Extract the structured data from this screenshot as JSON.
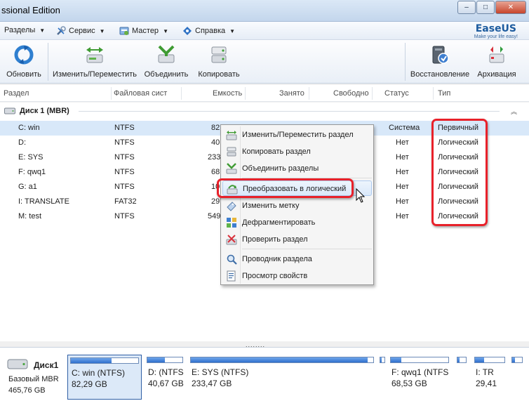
{
  "window": {
    "title": "ssional Edition",
    "buttons": {
      "minimize": "–",
      "maximize": "□",
      "close": "✕"
    }
  },
  "menubar": {
    "items": [
      {
        "label": "Разделы",
        "icon": "partitions-icon"
      },
      {
        "label": "Сервис",
        "icon": "tools-icon"
      },
      {
        "label": "Мастер",
        "icon": "wizard-icon"
      },
      {
        "label": "Справка",
        "icon": "help-icon"
      }
    ],
    "brand": {
      "name": "EaseUS",
      "tagline": "Make your life easy!"
    }
  },
  "toolbar": {
    "items": [
      {
        "label": "Обновить",
        "icon": "refresh-icon"
      },
      {
        "label": "Изменить/Переместить",
        "icon": "resize-move-icon"
      },
      {
        "label": "Объединить",
        "icon": "merge-icon"
      },
      {
        "label": "Копировать",
        "icon": "copy-disk-icon"
      },
      {
        "label": "Восстановление",
        "icon": "recovery-icon"
      },
      {
        "label": "Архивация",
        "icon": "backup-icon"
      }
    ]
  },
  "columns": [
    "Раздел",
    "Файловая сист",
    "Емкость",
    "Занято",
    "Свободно",
    "Статус",
    "Тип"
  ],
  "disk": {
    "header": "Диск 1 (MBR)",
    "partitions": [
      {
        "name": "C: win",
        "fs": "NTFS",
        "capacity": "82",
        "status": "Система",
        "type": "Первичный"
      },
      {
        "name": "D:",
        "fs": "NTFS",
        "capacity": "40",
        "status": "Нет",
        "type": "Логический"
      },
      {
        "name": "E: SYS",
        "fs": "NTFS",
        "capacity": "233",
        "status": "Нет",
        "type": "Логический"
      },
      {
        "name": "F: qwq1",
        "fs": "NTFS",
        "capacity": "68",
        "status": "Нет",
        "type": "Логический"
      },
      {
        "name": "G: a1",
        "fs": "NTFS",
        "capacity": "10",
        "status": "Нет",
        "type": "Логический"
      },
      {
        "name": "I: TRANSLATE",
        "fs": "FAT32",
        "capacity": "29",
        "status": "Нет",
        "type": "Логический"
      },
      {
        "name": "M: test",
        "fs": "NTFS",
        "capacity": "549",
        "status": "Нет",
        "type": "Логический"
      }
    ]
  },
  "context_menu": {
    "items": [
      {
        "label": "Изменить/Переместить раздел",
        "icon": "resize-move-icon"
      },
      {
        "label": "Копировать раздел",
        "icon": "copy-partition-icon"
      },
      {
        "label": "Объединить разделы",
        "icon": "merge-icon"
      },
      {
        "label": "Преобразовать в логический",
        "icon": "convert-logical-icon",
        "highlighted": true
      },
      {
        "label": "Изменить метку",
        "icon": "label-icon"
      },
      {
        "label": "Дефрагментировать",
        "icon": "defrag-icon"
      },
      {
        "label": "Проверить раздел",
        "icon": "check-partition-icon"
      },
      {
        "label": "Проводник раздела",
        "icon": "explorer-icon"
      },
      {
        "label": "Просмотр свойств",
        "icon": "properties-icon"
      }
    ]
  },
  "splitter": "........",
  "diskmap": {
    "name": "Диск1",
    "type": "Базовый MBR",
    "size": "465,76 GB",
    "partitions": [
      {
        "label": "C: win (NTFS)",
        "size": "82,29 GB",
        "used": 0.6,
        "selected": true
      },
      {
        "label": "D: (NTFS",
        "size": "40,67 GB",
        "used": 0.5
      },
      {
        "label": "E: SYS (NTFS)",
        "size": "233,47 GB",
        "used": 0.97
      },
      {
        "label": "",
        "size": "",
        "used": 0.4
      },
      {
        "label": "F: qwq1 (NTFS",
        "size": "68,53 GB",
        "used": 0.18
      },
      {
        "label": "",
        "size": "",
        "used": 0.25
      },
      {
        "label": "I: TR",
        "size": "29,41",
        "used": 0.3
      },
      {
        "label": "",
        "size": "",
        "used": 0.3
      }
    ]
  },
  "colors": {
    "highlight_frame": "#e8212a",
    "selection": "#d8e8f9",
    "used_fill": "#2f6fcd"
  }
}
